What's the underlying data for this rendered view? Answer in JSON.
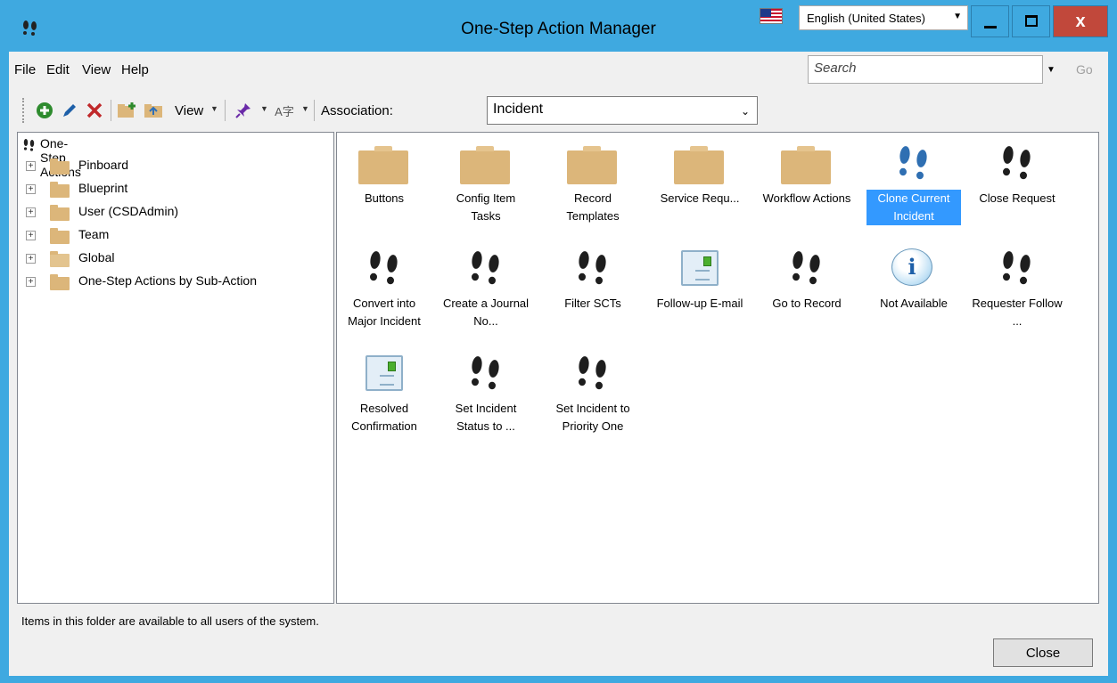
{
  "window": {
    "title": "One-Step Action Manager"
  },
  "language": {
    "selected": "English (United States)"
  },
  "menu": [
    "File",
    "Edit",
    "View",
    "Help"
  ],
  "search": {
    "placeholder": "Search",
    "go": "Go"
  },
  "toolbar": {
    "view_label": "View",
    "association_label": "Association:",
    "association_value": "Incident"
  },
  "tree": {
    "root": "One-Step Actions",
    "nodes": [
      "Pinboard",
      "Blueprint",
      "User (CSDAdmin)",
      "Team",
      "Global",
      "One-Step Actions by Sub-Action"
    ],
    "open_node": "Global"
  },
  "items": [
    {
      "label": "Buttons",
      "icon": "folder-icon"
    },
    {
      "label": "Config Item Tasks",
      "icon": "folder-icon"
    },
    {
      "label": "Record Templates",
      "icon": "folder-icon"
    },
    {
      "label": "Service Requ...",
      "icon": "folder-icon"
    },
    {
      "label": "Workflow Actions",
      "icon": "folder-icon"
    },
    {
      "label": "Clone Current Incident",
      "icon": "footprints-icon",
      "selected": true
    },
    {
      "label": "Close Request",
      "icon": "footprints-icon"
    },
    {
      "label": "Convert into Major Incident",
      "icon": "footprints-icon"
    },
    {
      "label": "Create a Journal No...",
      "icon": "footprints-icon"
    },
    {
      "label": "Filter SCTs",
      "icon": "footprints-icon"
    },
    {
      "label": "Follow-up E-mail",
      "icon": "email-icon"
    },
    {
      "label": "Go to Record",
      "icon": "footprints-icon"
    },
    {
      "label": "Not Available",
      "icon": "info-icon"
    },
    {
      "label": "Requester Follow ...",
      "icon": "footprints-icon"
    },
    {
      "label": "Resolved Confirmation",
      "icon": "email-icon"
    },
    {
      "label": "Set Incident Status to ...",
      "icon": "footprints-icon"
    },
    {
      "label": "Set Incident to Priority One",
      "icon": "footprints-icon"
    }
  ],
  "status": {
    "text": "Items in this folder are available to all users of the system."
  },
  "footer": {
    "close_label": "Close"
  },
  "colors": {
    "titlebar": "#3fa9e0",
    "selection": "#3399ff",
    "folder": "#dcb67a",
    "close_window": "#c1483b"
  }
}
